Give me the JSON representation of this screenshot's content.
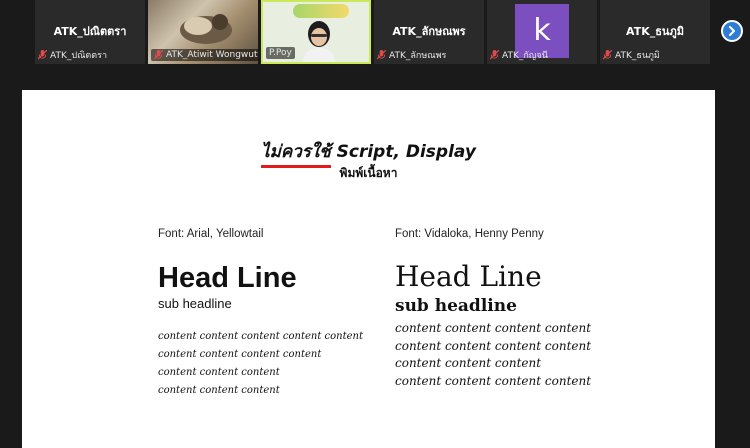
{
  "participants": [
    {
      "big_name": "ATK_ปณิตตรา",
      "label": "ATK_ปณิตตรา",
      "muted": true,
      "kind": "name"
    },
    {
      "big_name": "",
      "label": "ATK_Atiwit Wongwutt...",
      "muted": true,
      "kind": "video-cat"
    },
    {
      "big_name": "",
      "label": "P.Poy",
      "muted": false,
      "kind": "video-presenter"
    },
    {
      "big_name": "ATK_ลักษณพร",
      "label": "ATK_ลักษณพร",
      "muted": true,
      "kind": "name"
    },
    {
      "big_name": "",
      "label": "ATK_กัญจนี",
      "muted": true,
      "kind": "avatar",
      "avatar_letter": "k",
      "avatar_color": "#7b4fc0"
    },
    {
      "big_name": "ATK_ธนภูมิ",
      "label": "ATK_ธนภูมิ",
      "muted": true,
      "kind": "name"
    }
  ],
  "icons": {
    "mic_muted": "mic-muted-icon",
    "next": "chevron-right-icon"
  },
  "colors": {
    "accent_underline": "#e11a1a",
    "next_button": "#2e7bd8",
    "presenter_border": "#c9e85a"
  },
  "slide": {
    "title_prefix": "ไม่ควรใช้",
    "title_rest": " Script, Display",
    "subtitle": "พิมพ์เนื้อหา",
    "left": {
      "font_label": "Font:  Arial, Yellowtail",
      "headline": "Head Line",
      "subheadline": "sub headline",
      "content_lines": [
        "content content content content content",
        "content content content content",
        "content content content",
        "content content content"
      ]
    },
    "right": {
      "font_label": "Font: Vidaloka, Henny Penny",
      "headline": "Head Line",
      "subheadline": "sub headline",
      "content_lines": [
        "content content content content",
        "content content content content",
        "content content content",
        "content content content content"
      ]
    }
  }
}
